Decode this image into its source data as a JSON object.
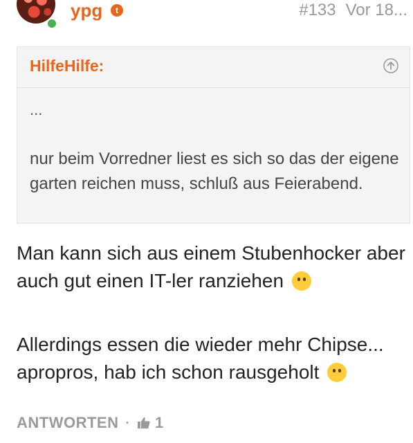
{
  "post": {
    "username": "ypg",
    "badge_letter": "t",
    "post_number": "#133",
    "time": "Vor 18...",
    "quote": {
      "author": "HilfeHilfe:",
      "ellipsis": "...",
      "text": "nur beim Vorredner liest es sich so das der eigene garten reichen muss, schluß aus Feierabend."
    },
    "paragraphs": [
      "Man kann sich aus einem Stubenhocker aber auch gut einen IT-ler ranziehen",
      "Allerdings essen die wieder mehr Chipse... apropros, hab ich schon rausgeholt"
    ],
    "footer": {
      "reply_label": "ANTWORTEN",
      "separator": "·",
      "like_count": "1"
    }
  },
  "colors": {
    "accent": "#e8651b",
    "online": "#4caf50",
    "meta": "#999999"
  },
  "icons": {
    "quote_up": "arrow-up-circle-icon",
    "like": "thumbs-up-icon",
    "emoji1": "thinking-face-emoji",
    "emoji2": "winking-face-emoji"
  }
}
